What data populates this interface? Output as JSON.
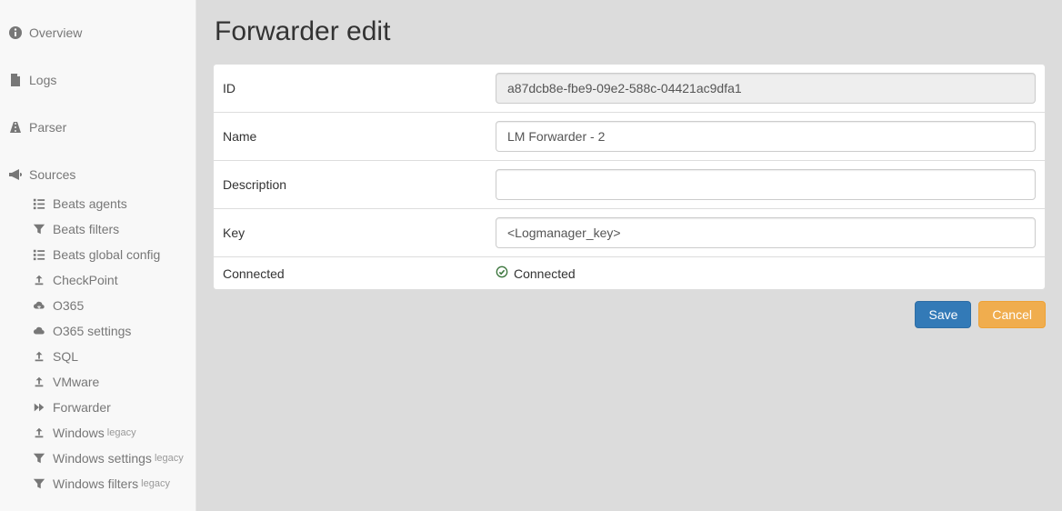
{
  "sidebar": {
    "overview": "Overview",
    "logs": "Logs",
    "parser": "Parser",
    "sources": "Sources",
    "items": [
      {
        "label": "Beats agents"
      },
      {
        "label": "Beats filters"
      },
      {
        "label": "Beats global config"
      },
      {
        "label": "CheckPoint"
      },
      {
        "label": "O365"
      },
      {
        "label": "O365 settings"
      },
      {
        "label": "SQL"
      },
      {
        "label": "VMware"
      },
      {
        "label": "Forwarder"
      },
      {
        "label": "Windows",
        "legacy": "legacy"
      },
      {
        "label": "Windows settings",
        "legacy": "legacy"
      },
      {
        "label": "Windows filters",
        "legacy": "legacy"
      }
    ]
  },
  "page": {
    "title": "Forwarder edit"
  },
  "form": {
    "id_label": "ID",
    "id_value": "a87dcb8e-fbe9-09e2-588c-04421ac9dfa1",
    "name_label": "Name",
    "name_value": "LM Forwarder - 2",
    "description_label": "Description",
    "description_value": "",
    "key_label": "Key",
    "key_value": "<Logmanager_key>",
    "connected_label": "Connected",
    "connected_status": "Connected"
  },
  "buttons": {
    "save": "Save",
    "cancel": "Cancel"
  }
}
